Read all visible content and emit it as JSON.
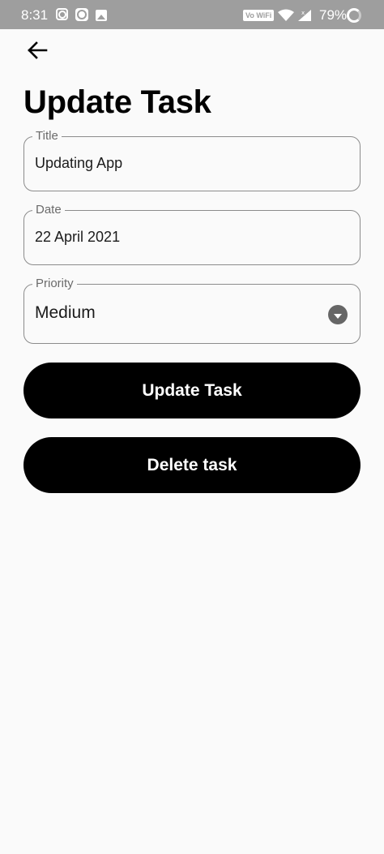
{
  "status_bar": {
    "time": "8:31",
    "vowifi": "Vo WiFi",
    "battery_percent": "79%",
    "icons": [
      "instagram-icon",
      "face-icon",
      "gallery-icon",
      "wifi-icon",
      "signal-icon",
      "battery-icon"
    ]
  },
  "header": {
    "back_icon": "arrow-left-icon",
    "title": "Update Task"
  },
  "form": {
    "title": {
      "label": "Title",
      "value": "Updating App"
    },
    "date": {
      "label": "Date",
      "value": "22 April 2021"
    },
    "priority": {
      "label": "Priority",
      "value": "Medium",
      "icon": "dropdown-circle-icon"
    }
  },
  "actions": {
    "update_label": "Update Task",
    "delete_label": "Delete task"
  },
  "colors": {
    "status_bar": "#9e9e9e",
    "background": "#fafafa",
    "button": "#000000",
    "button_text": "#ffffff",
    "field_border": "#8c8c8c"
  }
}
